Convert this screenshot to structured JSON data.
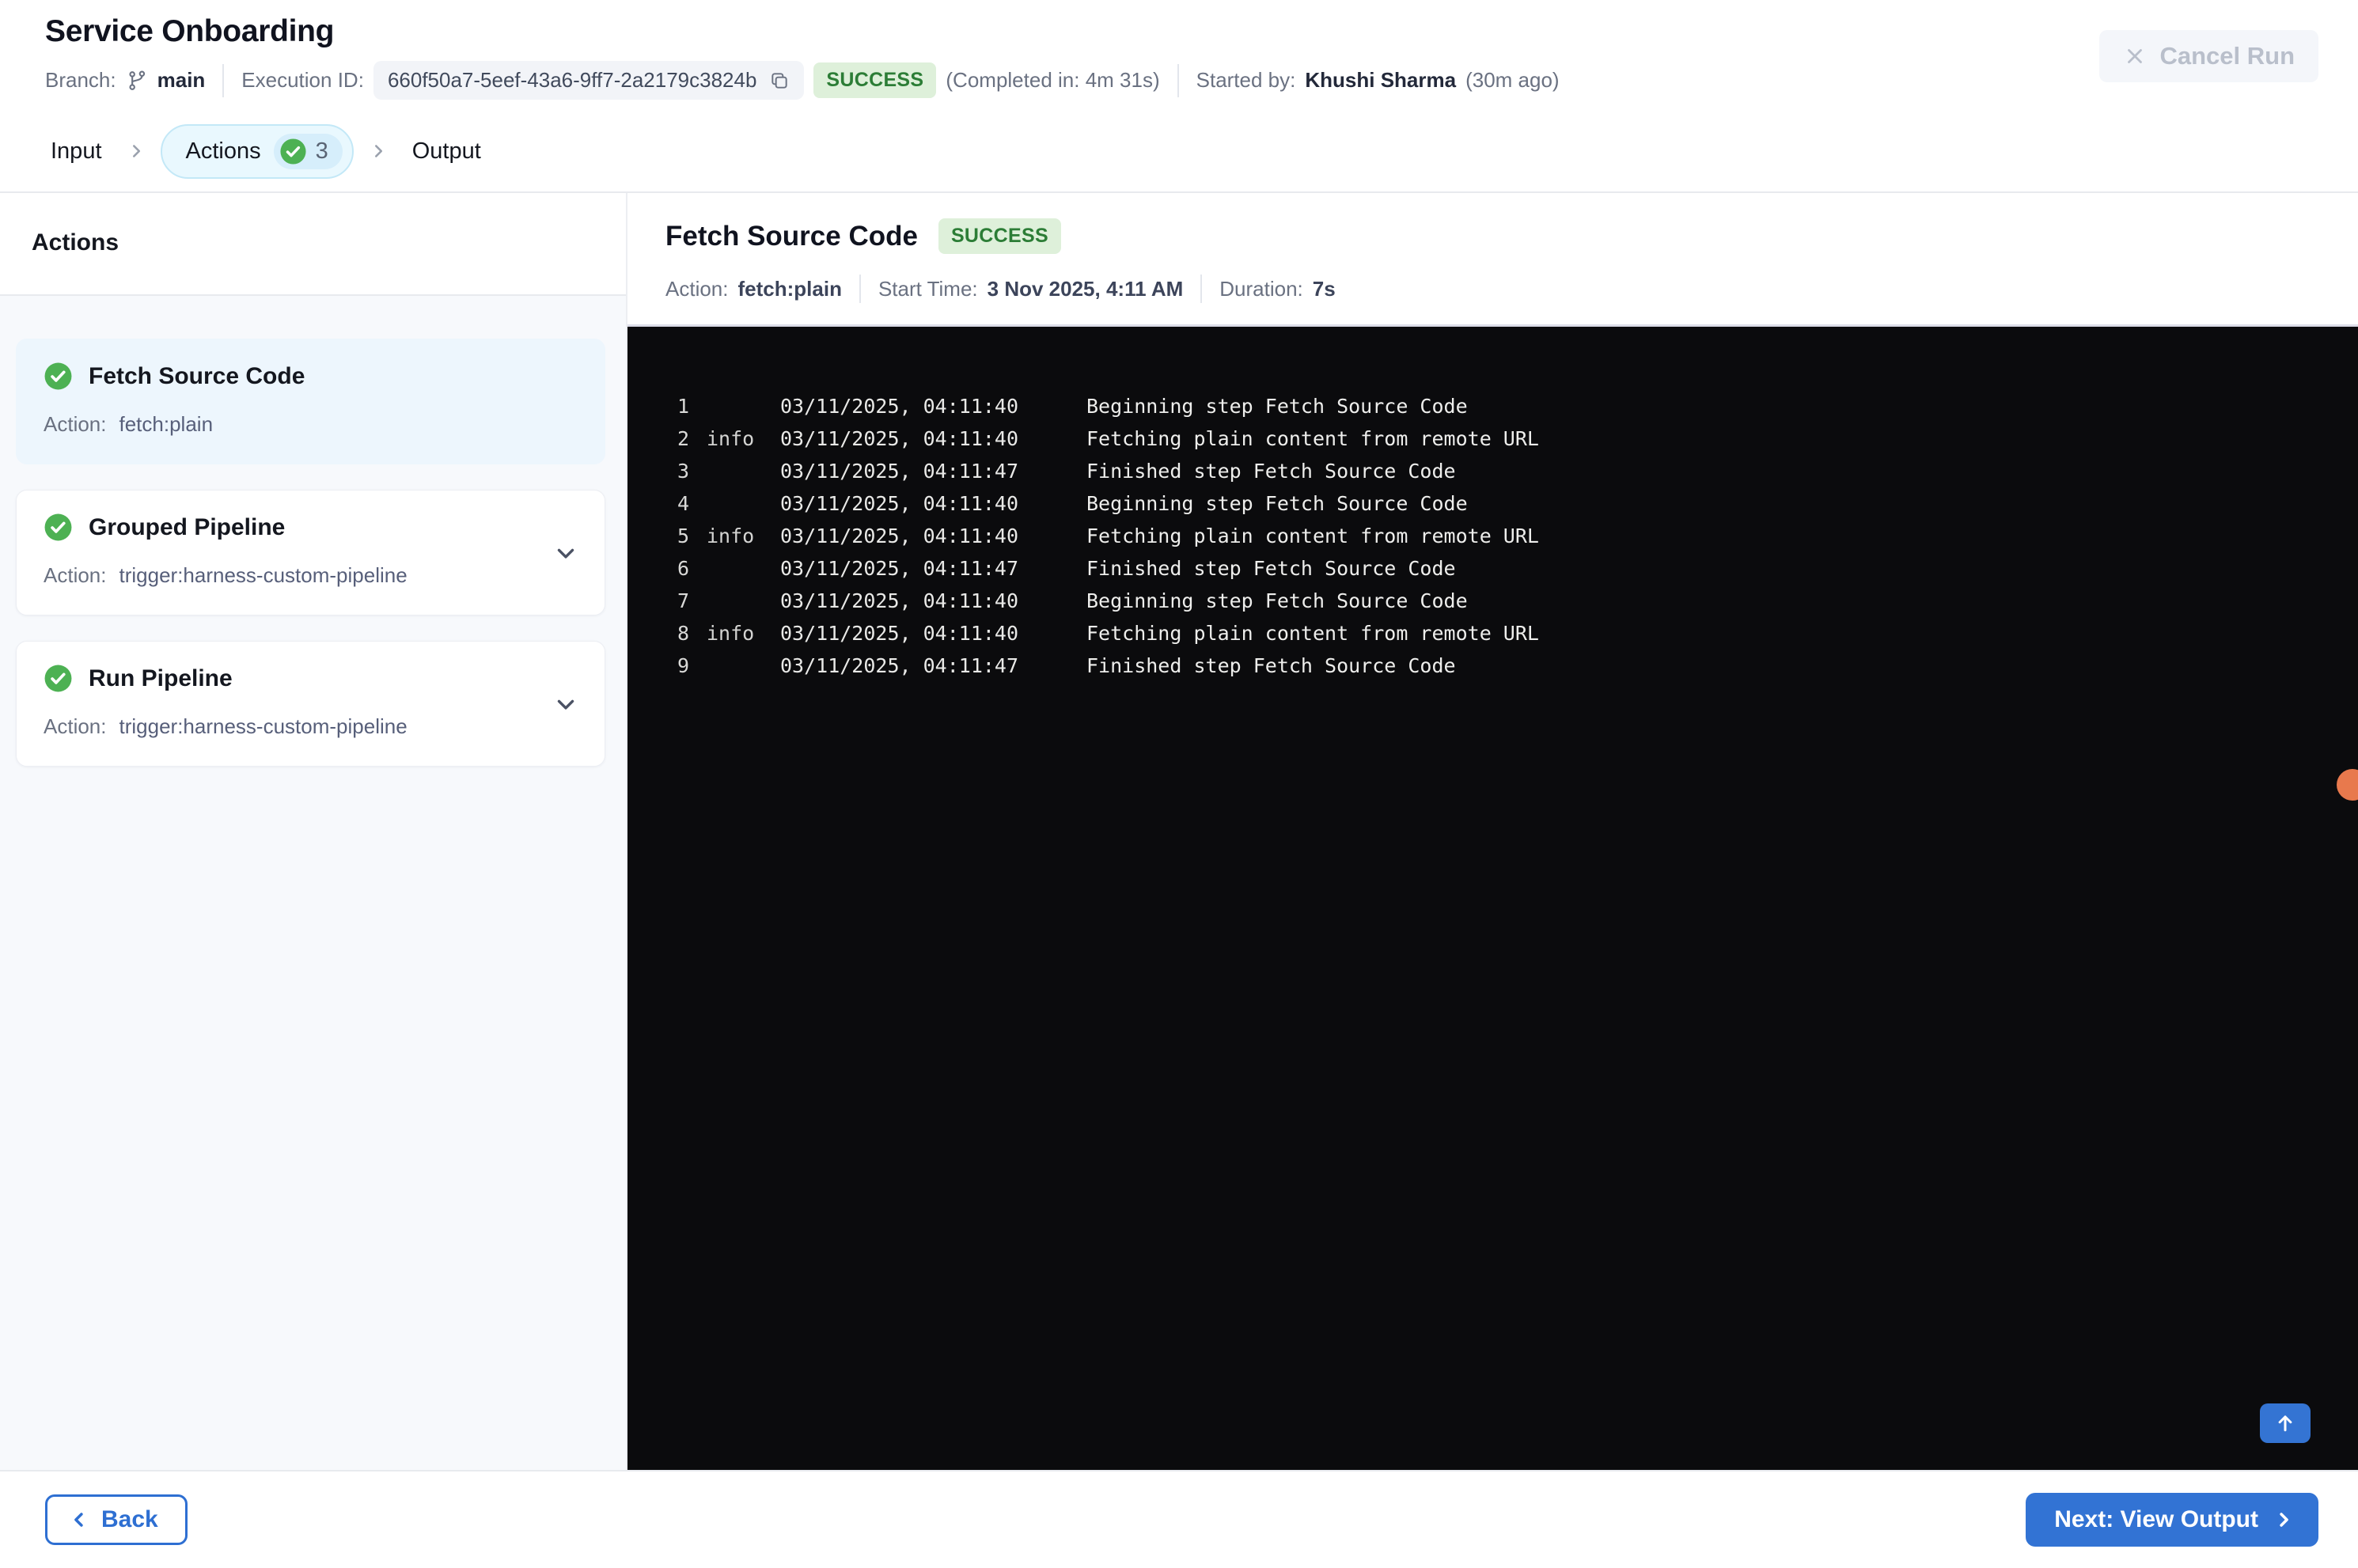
{
  "header": {
    "title": "Service Onboarding",
    "branch_label": "Branch:",
    "branch_value": "main",
    "execution_id_label": "Execution ID:",
    "execution_id": "660f50a7-5eef-43a6-9ff7-2a2179c3824b",
    "status_badge": "SUCCESS",
    "completed_in": "(Completed in: 4m 31s)",
    "started_by_label": "Started by:",
    "started_by_name": "Khushi Sharma",
    "started_ago": "(30m ago)",
    "cancel_run_label": "Cancel Run"
  },
  "tabs": {
    "input": "Input",
    "actions": "Actions",
    "actions_count": "3",
    "output": "Output"
  },
  "sidebar": {
    "heading": "Actions",
    "action_label": "Action:",
    "items": [
      {
        "title": "Fetch Source Code",
        "action": "fetch:plain",
        "status": "success",
        "selected": true
      },
      {
        "title": "Grouped Pipeline",
        "action": "trigger:harness-custom-pipeline",
        "status": "success",
        "selected": false
      },
      {
        "title": "Run Pipeline",
        "action": "trigger:harness-custom-pipeline",
        "status": "success",
        "selected": false
      }
    ]
  },
  "detail": {
    "title": "Fetch Source Code",
    "status_badge": "SUCCESS",
    "action_label": "Action:",
    "action_value": "fetch:plain",
    "start_time_label": "Start Time:",
    "start_time_value": "3 Nov 2025, 4:11 AM",
    "duration_label": "Duration:",
    "duration_value": "7s"
  },
  "console": {
    "lines": [
      {
        "num": "1",
        "level": "",
        "time": "03/11/2025, 04:11:40",
        "message": "Beginning step Fetch Source Code"
      },
      {
        "num": "2",
        "level": "info",
        "time": "03/11/2025, 04:11:40",
        "message": "Fetching plain content from remote URL"
      },
      {
        "num": "3",
        "level": "",
        "time": "03/11/2025, 04:11:47",
        "message": "Finished step Fetch Source Code"
      },
      {
        "num": "4",
        "level": "",
        "time": "03/11/2025, 04:11:40",
        "message": "Beginning step Fetch Source Code"
      },
      {
        "num": "5",
        "level": "info",
        "time": "03/11/2025, 04:11:40",
        "message": "Fetching plain content from remote URL"
      },
      {
        "num": "6",
        "level": "",
        "time": "03/11/2025, 04:11:47",
        "message": "Finished step Fetch Source Code"
      },
      {
        "num": "7",
        "level": "",
        "time": "03/11/2025, 04:11:40",
        "message": "Beginning step Fetch Source Code"
      },
      {
        "num": "8",
        "level": "info",
        "time": "03/11/2025, 04:11:40",
        "message": "Fetching plain content from remote URL"
      },
      {
        "num": "9",
        "level": "",
        "time": "03/11/2025, 04:11:47",
        "message": "Finished step Fetch Source Code"
      }
    ]
  },
  "footer": {
    "back_label": "Back",
    "next_label": "Next: View Output"
  },
  "colors": {
    "accent_blue": "#3273d4",
    "success_green": "#4db153",
    "success_badge_bg": "#def0da",
    "success_badge_text": "#2c7d36",
    "active_tab_bg": "#e9f8fe",
    "active_tab_border": "#c3e8f7",
    "selected_card_bg": "#edf6fd",
    "sidebar_bg": "#f7f9fc",
    "console_bg": "#0b0b0d",
    "notification_dot": "#e8794d"
  }
}
